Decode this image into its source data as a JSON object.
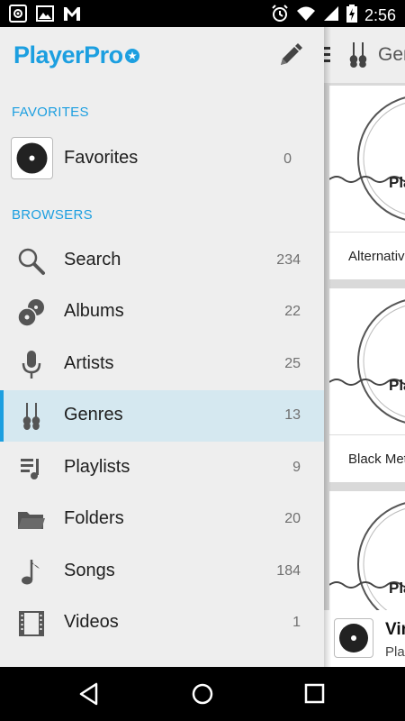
{
  "status_bar": {
    "time": "2:56",
    "left_icons": [
      "camera-icon",
      "image-icon",
      "gmail-icon"
    ],
    "right_icons": [
      "alarm-icon",
      "wifi-icon",
      "signal-icon",
      "battery-charging-icon"
    ]
  },
  "drawer": {
    "app_name": "PlayerPro",
    "edit_icon": "pencil-icon",
    "favorites_section": "FAVORITES",
    "favorites": {
      "label": "Favorites",
      "count": "0"
    },
    "browsers_section": "BROWSERS",
    "items": [
      {
        "label": "Search",
        "count": "234",
        "icon": "search-icon"
      },
      {
        "label": "Albums",
        "count": "22",
        "icon": "albums-icon"
      },
      {
        "label": "Artists",
        "count": "25",
        "icon": "microphone-icon"
      },
      {
        "label": "Genres",
        "count": "13",
        "icon": "guitars-icon",
        "selected": true
      },
      {
        "label": "Playlists",
        "count": "9",
        "icon": "playlist-icon"
      },
      {
        "label": "Folders",
        "count": "20",
        "icon": "folder-icon"
      },
      {
        "label": "Songs",
        "count": "184",
        "icon": "music-note-icon"
      },
      {
        "label": "Videos",
        "count": "1",
        "icon": "film-icon"
      }
    ]
  },
  "content": {
    "header_title": "Genres",
    "cards": [
      {
        "caption": "Alternative",
        "art_text": "Pla"
      },
      {
        "caption": "Black Metal",
        "art_text": "Pla"
      },
      {
        "caption": "",
        "art_text": "Pla"
      }
    ],
    "mini_player": {
      "title": "Vir",
      "subtitle": "Pla"
    }
  },
  "nav_bar": {
    "back": "back-icon",
    "home": "home-icon",
    "recents": "recents-icon"
  },
  "colors": {
    "accent": "#1c9fe0",
    "drawer_bg": "#eeeeee",
    "selected_bg": "#d5e8f0"
  }
}
